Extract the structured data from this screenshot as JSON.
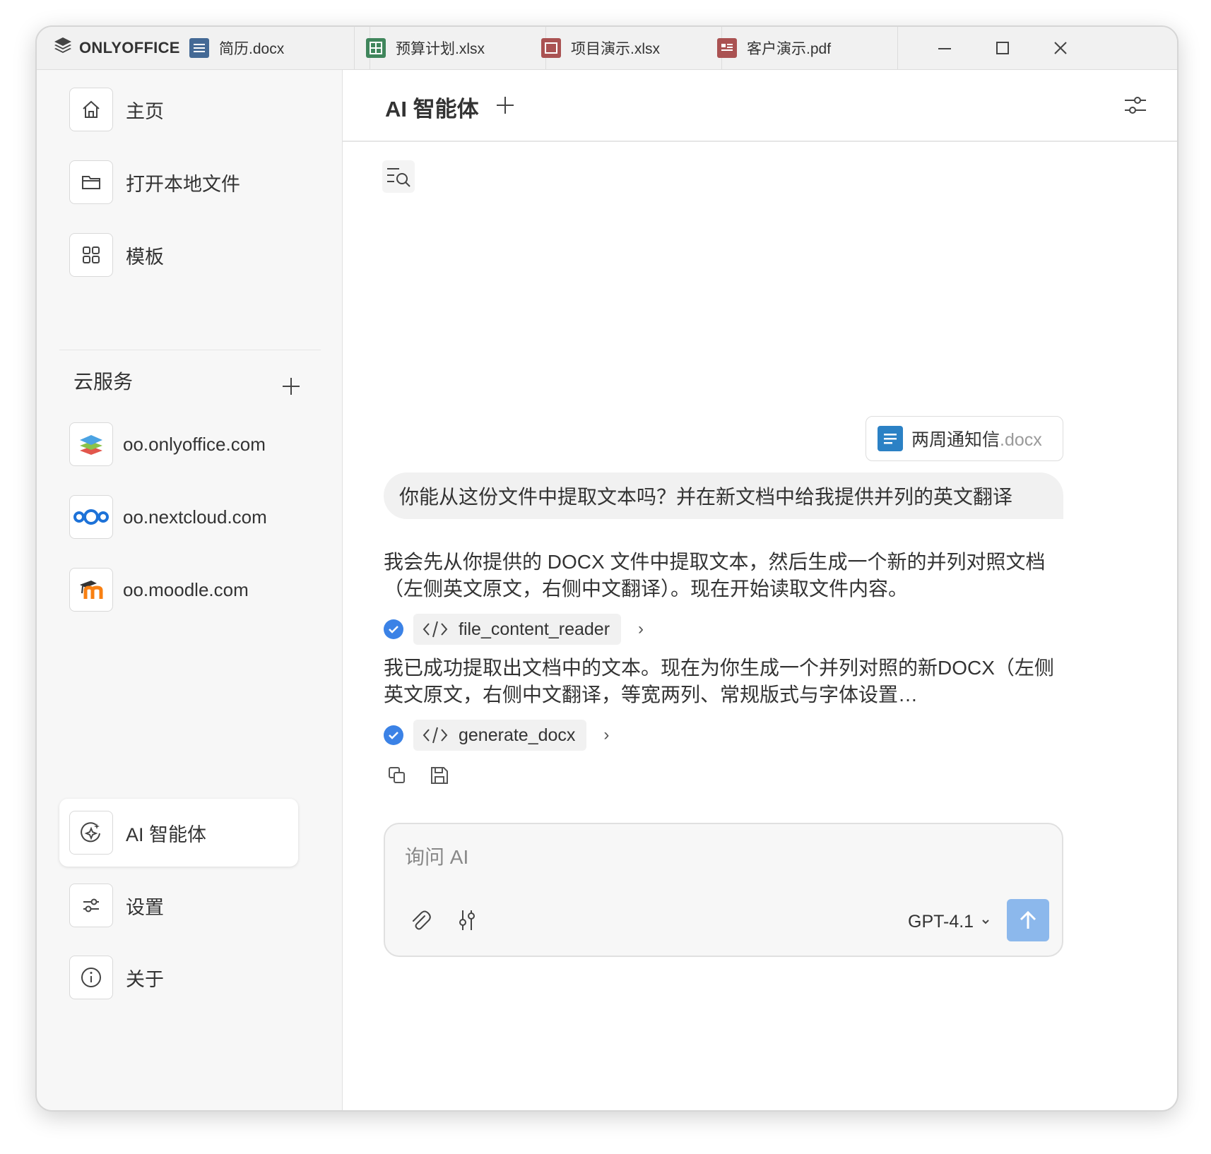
{
  "app": {
    "brand": "ONLYOFFICE"
  },
  "tabs": [
    {
      "name": "简历.docx",
      "icon": "document-icon",
      "color": "#446995"
    },
    {
      "name": "预算计划.xlsx",
      "icon": "spreadsheet-icon",
      "color": "#40865c"
    },
    {
      "name": "项目演示.xlsx",
      "icon": "presentation-icon",
      "color": "#aa5252"
    },
    {
      "name": "客户演示.pdf",
      "icon": "pdf-icon",
      "color": "#aa5252"
    }
  ],
  "sidebar": {
    "items": [
      {
        "label": "主页",
        "icon": "home-icon"
      },
      {
        "label": "打开本地文件",
        "icon": "folder-icon"
      },
      {
        "label": "模板",
        "icon": "grid-icon"
      }
    ],
    "cloud": {
      "title": "云服务",
      "services": [
        {
          "label": "oo.onlyoffice.com",
          "icon": "onlyoffice-logo-icon"
        },
        {
          "label": "oo.nextcloud.com",
          "icon": "nextcloud-logo-icon"
        },
        {
          "label": "oo.moodle.com",
          "icon": "moodle-logo-icon"
        }
      ]
    },
    "bottom": [
      {
        "label": "AI 智能体",
        "icon": "ai-agent-icon",
        "active": true
      },
      {
        "label": "设置",
        "icon": "settings-icon"
      },
      {
        "label": "关于",
        "icon": "info-icon"
      }
    ]
  },
  "main": {
    "title": "AI 智能体",
    "attachment": {
      "name": "两周通知信",
      "ext": ".docx"
    },
    "user_message": "你能从这份文件中提取文本吗？并在新文档中给我提供并列的英文翻译",
    "ai_message_1": "我会先从你提供的 DOCX 文件中提取文本，然后生成一个新的并列对照文档（左侧英文原文，右侧中文翻译）。现在开始读取文件内容。",
    "tool_1": "file_content_reader",
    "ai_message_2": "我已成功提取出文档中的文本。现在为你生成一个并列对照的新DOCX（左侧英文原文，右侧中文翻译，等宽两列、常规版式与字体设置…",
    "tool_2": "generate_docx"
  },
  "composer": {
    "placeholder": "询问 AI",
    "model": "GPT-4.1"
  },
  "colors": {
    "accent": "#3b82e6",
    "send_button": "#8cb8ec"
  }
}
